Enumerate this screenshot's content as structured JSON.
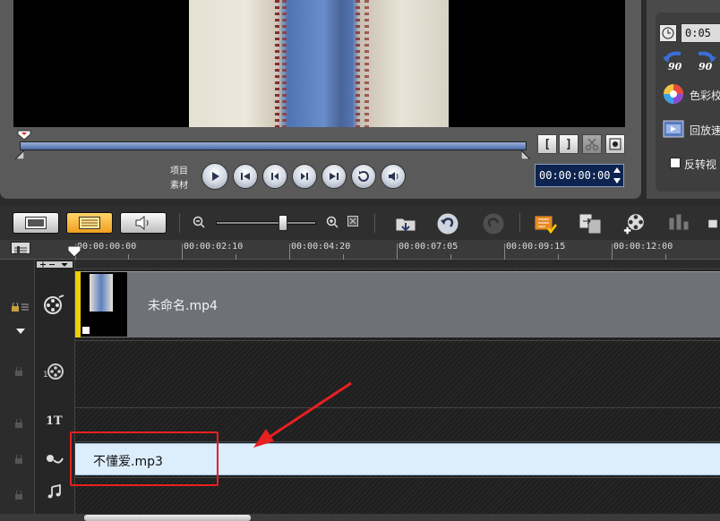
{
  "preview": {
    "mode_project": "项目",
    "mode_clip": "素材",
    "timecode": "00:00:00:00",
    "mark_in": "[",
    "mark_out": "]"
  },
  "options": {
    "duration": "0:05",
    "rotate_left_label": "90",
    "rotate_right_label": "90",
    "color_label": "色彩校",
    "playback_label": "回放速",
    "reverse_label": "反转视"
  },
  "ruler": {
    "labels": [
      "00:00:00:00",
      "00:00:02:10",
      "00:00:04:20",
      "00:00:07:05",
      "00:00:09:15",
      "00:00:12:00"
    ]
  },
  "tracks": {
    "video_clip_name": "未命名.mp4",
    "audio_clip_name": "不懂爱.mp3",
    "overlay_number": "1",
    "title_label": "1T"
  },
  "colors": {
    "accent_timeline": "#4c6aa8",
    "audio_clip_bg": "#dceefc",
    "annotation_red": "#e82020",
    "active_view": "#f0a020"
  }
}
